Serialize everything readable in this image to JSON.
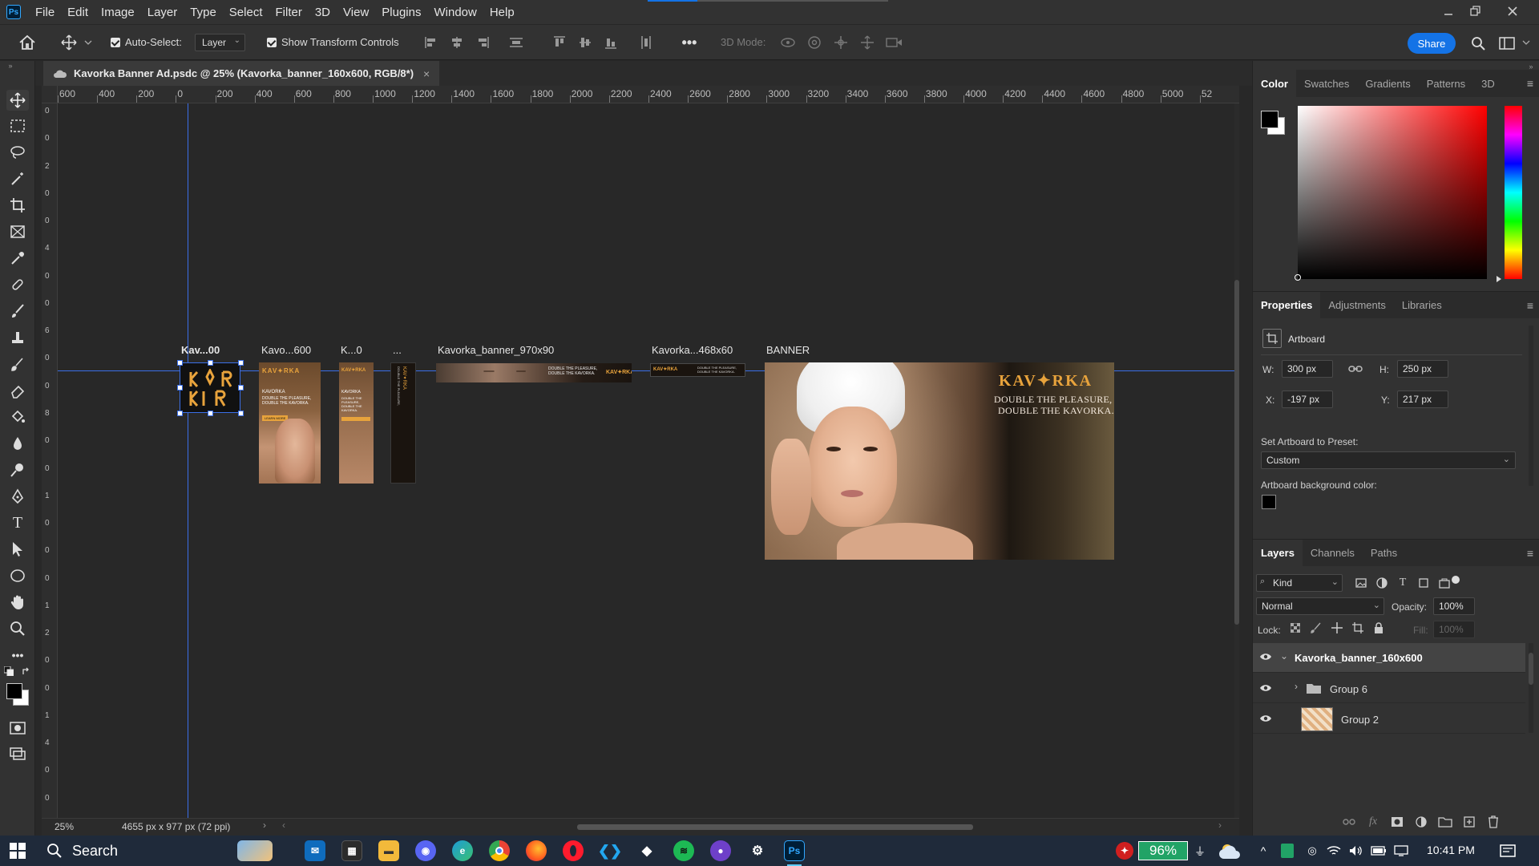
{
  "app": {
    "name": "Photoshop",
    "logo": "Ps"
  },
  "menu": [
    "File",
    "Edit",
    "Image",
    "Layer",
    "Type",
    "Select",
    "Filter",
    "3D",
    "View",
    "Plugins",
    "Window",
    "Help"
  ],
  "options": {
    "auto_select_label": "Auto-Select:",
    "auto_select_value": "Layer",
    "transform_label": "Show Transform Controls",
    "mode3d_label": "3D Mode:",
    "share_label": "Share"
  },
  "document": {
    "tab_title": "Kavorka Banner Ad.psdc @ 25% (Kavorka_banner_160x600, RGB/8*)",
    "close": "×"
  },
  "ruler_top": [
    "600",
    "400",
    "200",
    "0",
    "200",
    "400",
    "600",
    "800",
    "1000",
    "1200",
    "1400",
    "1600",
    "1800",
    "2000",
    "2200",
    "2400",
    "2600",
    "2800",
    "3000",
    "3200",
    "3400",
    "3600",
    "3800",
    "4000",
    "4200",
    "4400",
    "4600",
    "4800",
    "5000",
    "52"
  ],
  "ruler_left": [
    "0",
    "0",
    "2",
    "0",
    "0",
    "4",
    "0",
    "0",
    "6",
    "0",
    "0",
    "8",
    "0",
    "0",
    "1",
    "0",
    "0",
    "0",
    "1",
    "2",
    "0",
    "0",
    "1",
    "4",
    "0",
    "0"
  ],
  "artboards": [
    {
      "label": "Kav...00"
    },
    {
      "label": "Kavo...600"
    },
    {
      "label": "K...0"
    },
    {
      "label": "..."
    },
    {
      "label": "Kavorka_banner_970x90"
    },
    {
      "label": "Kavorka...468x60"
    },
    {
      "label": "BANNER"
    }
  ],
  "banner_text": {
    "brand": "KAV✦RKA",
    "brand_small": "KAVORKA",
    "headline_1": "DOUBLE THE PLEASURE,",
    "headline_2": "DOUBLE THE KAVORKA.",
    "cta": "LEARN MORE"
  },
  "status": {
    "zoom": "25%",
    "doc_size": "4655 px x 977 px (72 ppi)"
  },
  "color_panel": {
    "tabs": [
      "Color",
      "Swatches",
      "Gradients",
      "Patterns",
      "3D"
    ]
  },
  "properties_panel": {
    "tabs": [
      "Properties",
      "Adjustments",
      "Libraries"
    ],
    "type": "Artboard",
    "w_label": "W:",
    "w": "300 px",
    "h_label": "H:",
    "h": "250 px",
    "x_label": "X:",
    "x": "-197 px",
    "y_label": "Y:",
    "y": "217 px",
    "preset_label": "Set Artboard to Preset:",
    "preset_value": "Custom",
    "bg_label": "Artboard background color:"
  },
  "layers_panel": {
    "tabs": [
      "Layers",
      "Channels",
      "Paths"
    ],
    "filter_kind": "Kind",
    "blend_mode": "Normal",
    "opacity_label": "Opacity:",
    "opacity": "100%",
    "lock_label": "Lock:",
    "fill_label": "Fill:",
    "fill": "100%",
    "layers": [
      {
        "name": "Kavorka_banner_160x600"
      },
      {
        "name": "Group 6"
      },
      {
        "name": "Group 2"
      }
    ]
  },
  "taskbar": {
    "search_placeholder": "Search",
    "battery": "96%",
    "time": "10:41 PM"
  },
  "colors": {
    "accent": "#1473e6",
    "brand_gold": "#e8a33c",
    "guide": "#3b6fe8"
  }
}
